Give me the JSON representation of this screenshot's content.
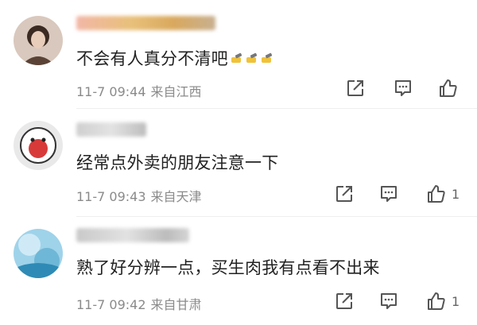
{
  "comments": [
    {
      "text": "不会有人真分不清吧",
      "sticker_count": 3,
      "sticker_icon": "salute-emoji-icon",
      "time": "11-7 09:44",
      "location": "来自江西",
      "like_count": ""
    },
    {
      "text": "经常点外卖的朋友注意一下",
      "time": "11-7 09:43",
      "location": "来自天津",
      "like_count": "1"
    },
    {
      "text": "熟了好分辨一点，买生肉我有点看不出来",
      "time": "11-7 09:42",
      "location": "来自甘肃",
      "like_count": "1"
    }
  ],
  "colors": {
    "text": "#222222",
    "meta": "#8a8a8a",
    "icon": "#555555"
  }
}
